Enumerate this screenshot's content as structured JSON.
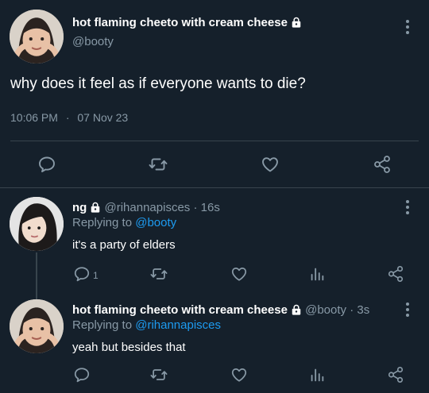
{
  "main_tweet": {
    "display_name": "hot flaming cheeto with cream cheese",
    "handle": "@booty",
    "text": "why does it feel as if everyone wants to die?",
    "time": "10:06 PM",
    "dot": "·",
    "date": "07 Nov 23"
  },
  "replies": [
    {
      "display_name": "ng",
      "handle": "@rihannapisces",
      "sep": "·",
      "age": "16s",
      "replying_label": "Replying to",
      "replying_to": "@booty",
      "text": "it's a party of elders",
      "reply_count": "1"
    },
    {
      "display_name": "hot flaming cheeto with cream cheese",
      "handle": "@booty",
      "sep": "·",
      "age": "3s",
      "replying_label": "Replying to",
      "replying_to": "@rihannapisces",
      "text": "yeah but besides that"
    }
  ],
  "colors": {
    "background": "#15202b",
    "muted": "#8899a6",
    "link": "#1d9bf0",
    "divider": "#38444d"
  },
  "icons": [
    "lock-icon",
    "more-icon",
    "reply-icon",
    "retweet-icon",
    "like-icon",
    "share-icon",
    "analytics-icon"
  ]
}
